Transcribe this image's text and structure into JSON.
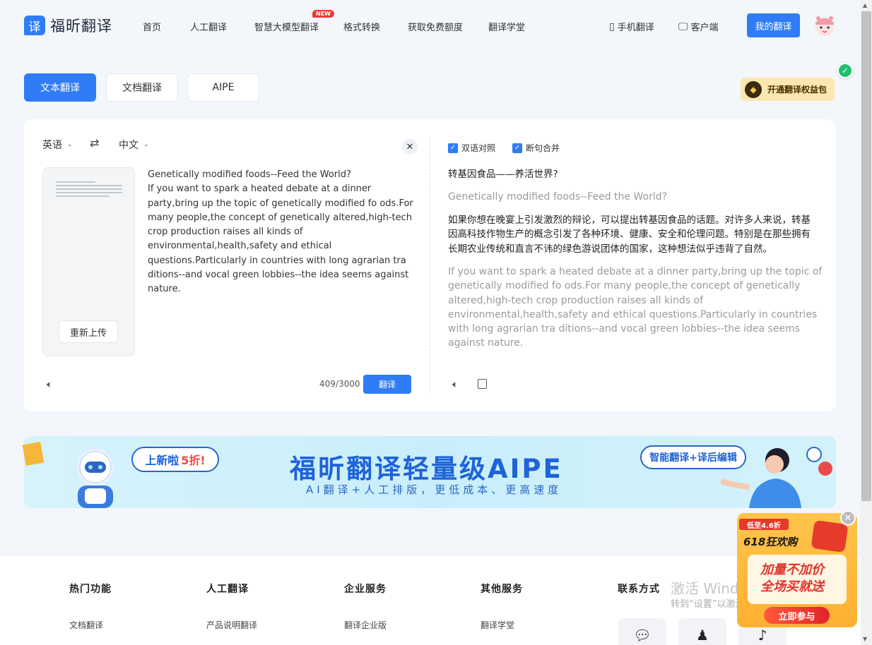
{
  "header": {
    "logo_glyph": "译",
    "logo_text": "福昕翻译",
    "nav": [
      "首页",
      "人工翻译",
      "智慧大模型翻译",
      "格式转换",
      "获取免费额度",
      "翻译学堂"
    ],
    "new_badge": "NEW",
    "mobile_label": "手机翻译",
    "client_label": "客户端",
    "my_translation": "我的翻译"
  },
  "tabs": [
    "文本翻译",
    "文档翻译",
    "AIPE"
  ],
  "benefit_label": "开通翻译权益包",
  "translator": {
    "source_lang": "英语",
    "target_lang": "中文",
    "reupload": "重新上传",
    "source_text": "Genetically modified foods--Feed the World?\nIf you want to spark a heated debate at a dinner party,bring up the topic of genetically modified fo ods.For many people,the concept of genetically altered,high-tech crop production raises all kinds of environmental,health,safety and ethical questions.Particularly in countries with long agrarian tra ditions--and vocal green lobbies--the idea seems against nature.",
    "char_count": "409/3000",
    "translate_button": "翻译",
    "bilingual_label": "双语对照",
    "merge_label": "断句合并",
    "output": [
      {
        "cn": "转基因食品——养活世界?",
        "en": "Genetically modified foods--Feed the World?"
      },
      {
        "cn": "如果你想在晚宴上引发激烈的辩论，可以提出转基因食品的话题。对许多人来说，转基因高科技作物生产的概念引发了各种环境、健康、安全和伦理问题。特别是在那些拥有长期农业传统和直言不讳的绿色游说团体的国家，这种想法似乎违背了自然。",
        "en": "If you want to spark a heated debate at a dinner party,bring up the topic of genetically modified fo ods.For many people,the concept of genetically altered,high-tech crop production raises all kinds of environmental,health,safety and ethical questions.Particularly in countries with long agrarian tra ditions--and vocal green lobbies--the idea seems against nature."
      }
    ]
  },
  "banner": {
    "pill_left": "上新啦",
    "pill_left_discount": "5折!",
    "title": "福昕翻译轻量级AIPE",
    "subtitle": "AI翻译+人工排版，更低成本、更高速度",
    "pill_right": "智能翻译+译后编辑"
  },
  "footer": {
    "columns": [
      {
        "title": "热门功能",
        "link": "文档翻译"
      },
      {
        "title": "人工翻译",
        "link": "产品说明翻译"
      },
      {
        "title": "企业服务",
        "link": "翻译企业版"
      },
      {
        "title": "其他服务",
        "link": "翻译学堂"
      },
      {
        "title": "联系方式",
        "link": ""
      }
    ]
  },
  "watermark": {
    "line1": "激活 Windows",
    "line2": "转到“设置”以激活 Windows。"
  },
  "promo": {
    "tag": "低至4.6折",
    "headline": "618狂欢购",
    "line1": "加量不加价",
    "line2": "全场买就送",
    "button": "立即参与"
  },
  "colors": {
    "primary": "#2f7cf6",
    "promo_red": "#e3342a"
  }
}
